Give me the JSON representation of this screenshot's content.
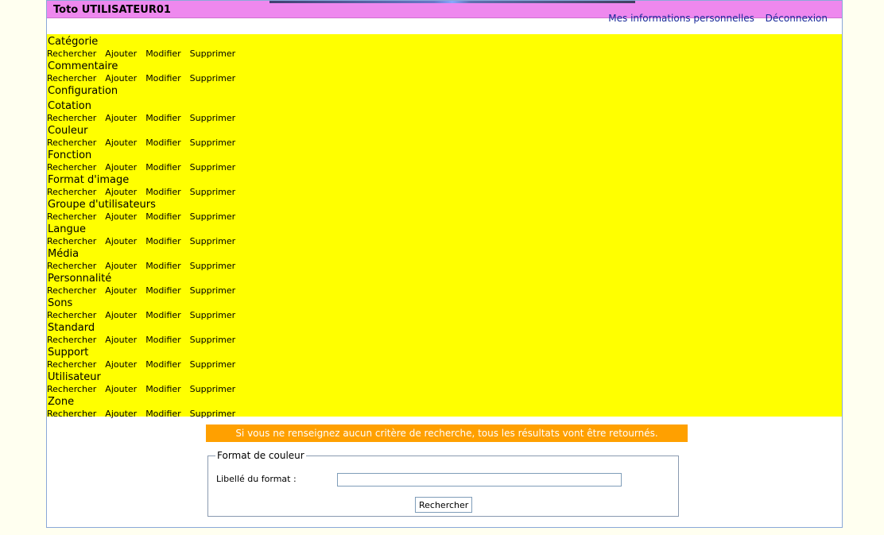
{
  "header": {
    "username": "Toto UTILISATEUR01",
    "links": {
      "profile": "Mes informations personnelles",
      "logout": "Déconnexion"
    }
  },
  "menu": {
    "action_labels": {
      "search": "Rechercher",
      "add": "Ajouter",
      "edit": "Modifier",
      "delete": "Supprimer"
    },
    "categories": [
      {
        "label": "Catégorie",
        "has_actions": true
      },
      {
        "label": "Commentaire",
        "has_actions": true
      },
      {
        "label": "Configuration",
        "has_actions": false
      },
      {
        "label": "Cotation",
        "has_actions": true
      },
      {
        "label": "Couleur",
        "has_actions": true
      },
      {
        "label": "Fonction",
        "has_actions": true
      },
      {
        "label": "Format d'image",
        "has_actions": true
      },
      {
        "label": "Groupe d'utilisateurs",
        "has_actions": true
      },
      {
        "label": "Langue",
        "has_actions": true
      },
      {
        "label": "Média",
        "has_actions": true
      },
      {
        "label": "Personnalité",
        "has_actions": true
      },
      {
        "label": "Sons",
        "has_actions": true
      },
      {
        "label": "Standard",
        "has_actions": true
      },
      {
        "label": "Support",
        "has_actions": true
      },
      {
        "label": "Utilisateur",
        "has_actions": true
      },
      {
        "label": "Zone",
        "has_actions": true
      }
    ]
  },
  "notice": "Si vous ne renseignez aucun critère de recherche, tous les résultats vont être retournés.",
  "form": {
    "legend": "Format de couleur",
    "field_label": "Libellé du format :",
    "field_value": "",
    "submit_label": "Rechercher"
  },
  "colors": {
    "menu_bg": "#ffff00",
    "header_bg": "#ee88ee",
    "notice_bg": "#ffa000"
  }
}
